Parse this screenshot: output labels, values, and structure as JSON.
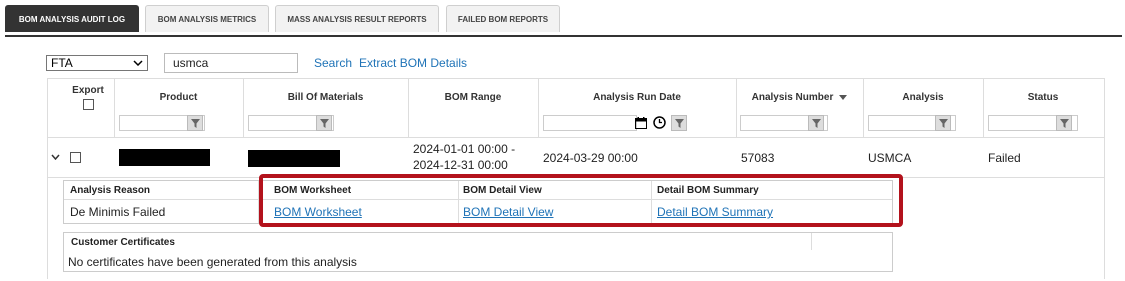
{
  "tabs": [
    {
      "label": "BOM ANALYSIS AUDIT LOG",
      "active": true
    },
    {
      "label": "BOM ANALYSIS METRICS",
      "active": false
    },
    {
      "label": "MASS ANALYSIS RESULT REPORTS",
      "active": false
    },
    {
      "label": "FAILED BOM REPORTS",
      "active": false
    }
  ],
  "filters": {
    "type_select": "FTA",
    "search_text": "usmca",
    "search_link": "Search",
    "extract_link": "Extract BOM Details"
  },
  "columns": {
    "export": "Export",
    "product": "Product",
    "bill_of_materials": "Bill Of Materials",
    "bom_range": "BOM Range",
    "analysis_run_date": "Analysis Run Date",
    "analysis_number": "Analysis Number",
    "analysis": "Analysis",
    "status": "Status"
  },
  "row": {
    "bom_range_start": "2024-01-01 00:00 -",
    "bom_range_end": "2024-12-31 00:00",
    "analysis_run_date": "2024-03-29 00:00",
    "analysis_number": "57083",
    "analysis": "USMCA",
    "status": "Failed"
  },
  "detail": {
    "analysis_reason_header": "Analysis Reason",
    "analysis_reason_value": "De Minimis Failed",
    "bom_worksheet_header": "BOM Worksheet",
    "bom_worksheet_link": "BOM Worksheet",
    "bom_detail_view_header": "BOM Detail View",
    "bom_detail_view_link": "BOM Detail View",
    "detail_bom_summary_header": "Detail BOM Summary",
    "detail_bom_summary_link": "Detail BOM Summary"
  },
  "certificates": {
    "header": "Customer Certificates",
    "message": "No certificates have been generated from this analysis"
  },
  "colors": {
    "accent_red": "#b3121c",
    "link_blue": "#1f73b7",
    "active_tab": "#333333"
  }
}
